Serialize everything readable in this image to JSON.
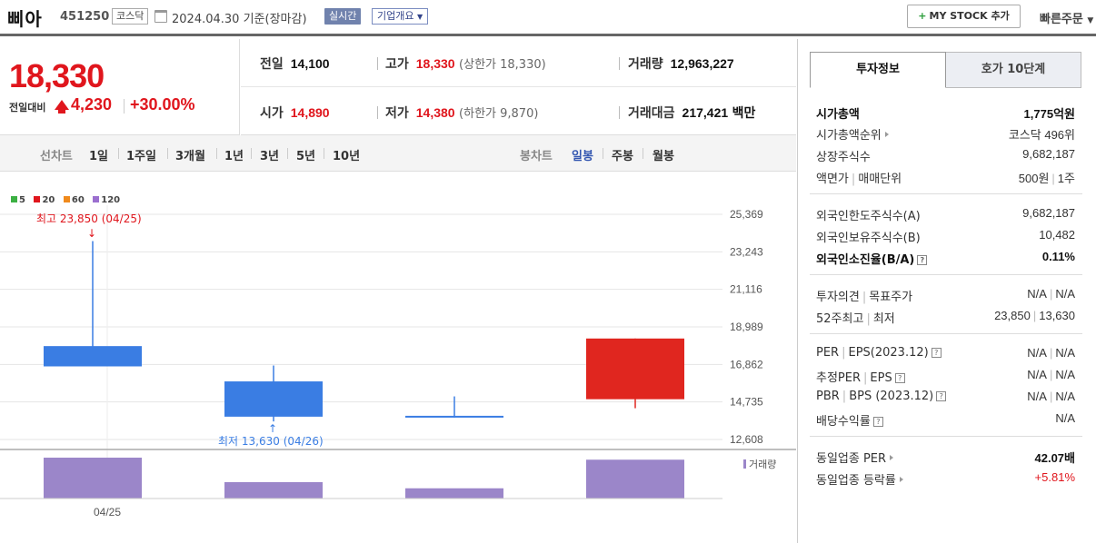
{
  "header": {
    "name": "삐아",
    "code": "451250",
    "market": "코스닥",
    "date": "2024.04.30",
    "basis": "기준(장마감)",
    "realtime_label": "실시간",
    "overview_label": "기업개요",
    "mystock_plus": "+",
    "mystock_label": "MY STOCK 추가",
    "quick_order": "빠른주문"
  },
  "price": {
    "current": "18,330",
    "change_label": "전일대비",
    "change": "4,230",
    "change_pct": "+30.00%"
  },
  "quotes": {
    "prev_label": "전일",
    "prev": "14,100",
    "high_label": "고가",
    "high": "18,330",
    "upper_limit": "(상한가 18,330)",
    "volume_label": "거래량",
    "volume": "12,963,227",
    "open_label": "시가",
    "open": "14,890",
    "low_label": "저가",
    "low": "14,380",
    "lower_limit": "(하한가 9,870)",
    "amount_label": "거래대금",
    "amount": "217,421",
    "amount_unit": "백만"
  },
  "periods": {
    "line_label": "선차트",
    "line_items": [
      "1일",
      "1주일",
      "3개월",
      "1년",
      "3년",
      "5년",
      "10년"
    ],
    "candle_label": "봉차트",
    "candle_items": [
      "일봉",
      "주봉",
      "월봉"
    ],
    "active_candle": "일봉"
  },
  "chart_data": {
    "type": "candlestick",
    "legend": [
      {
        "name": "5",
        "color": "#3cb043"
      },
      {
        "name": "20",
        "color": "#e0161d"
      },
      {
        "name": "60",
        "color": "#f08a1c"
      },
      {
        "name": "120",
        "color": "#9b6fcf"
      }
    ],
    "y_ticks": [
      "25,369",
      "23,243",
      "21,116",
      "18,989",
      "16,862",
      "14,735",
      "12,608"
    ],
    "ylim": [
      12608,
      25369
    ],
    "x_tick": "04/25",
    "candles": [
      {
        "open": 17900,
        "close": 16750,
        "high": 23850,
        "low": 16750,
        "dir": "down"
      },
      {
        "open": 15900,
        "close": 13900,
        "high": 16800,
        "low": 13630,
        "dir": "down"
      },
      {
        "open": 13950,
        "close": 13850,
        "high": 15050,
        "low": 13850,
        "dir": "down"
      },
      {
        "open": 14890,
        "close": 18330,
        "high": 18330,
        "low": 14380,
        "dir": "up"
      }
    ],
    "volume_label": "거래량",
    "volumes": [
      100,
      40,
      25,
      95
    ],
    "max_annotation": "최고 23,850 (04/25)",
    "min_annotation": "최저 13,630 (04/26)",
    "colors": {
      "up": "#e0261f",
      "down": "#3a7de3",
      "volume": "#9b86c9"
    }
  },
  "invest": {
    "tab_on": "투자정보",
    "tab_off": "호가 10단계",
    "market_cap_label": "시가총액",
    "market_cap": "1,775억원",
    "rank_label": "시가총액순위",
    "rank": "코스닥 496위",
    "shares_label": "상장주식수",
    "shares": "9,682,187",
    "par_label": "액면가",
    "unit_label": "매매단위",
    "par": "500원",
    "unit": "1주",
    "foreign_limit_label": "외국인한도주식수(A)",
    "foreign_limit": "9,682,187",
    "foreign_hold_label": "외국인보유주식수(B)",
    "foreign_hold": "10,482",
    "foreign_rate_label": "외국인소진율(B/A)",
    "foreign_rate": "0.11%",
    "opinion_label": "투자의견",
    "target_label": "목표주가",
    "opinion": "N/A",
    "target": "N/A",
    "w52_high_label": "52주최고",
    "w52_low_label": "최저",
    "w52_high": "23,850",
    "w52_low": "13,630",
    "per_label": "PER",
    "eps_label": "EPS(2023.12)",
    "per": "N/A",
    "eps": "N/A",
    "est_per_label": "추정PER",
    "est_eps_label": "EPS",
    "est_per": "N/A",
    "est_eps": "N/A",
    "pbr_label": "PBR",
    "bps_label": "BPS (2023.12)",
    "pbr": "N/A",
    "bps": "N/A",
    "div_label": "배당수익률",
    "div": "N/A",
    "sector_per_label": "동일업종 PER",
    "sector_per": "42.07배",
    "sector_chg_label": "동일업종 등락률",
    "sector_chg": "+5.81%",
    "q_mark": "?"
  }
}
